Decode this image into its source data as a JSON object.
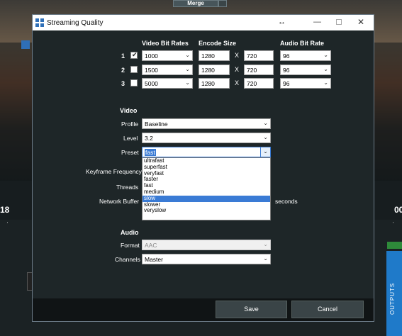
{
  "background": {
    "merge_label": "Merge",
    "left_number": "18",
    "right_number": "00",
    "outputs_label": "OUTPUTS"
  },
  "dialog": {
    "title": "Streaming Quality",
    "move_glyph": "↔",
    "minimize_glyph": "—",
    "close_glyph": "✕"
  },
  "table": {
    "headers": {
      "video_bit_rates": "Video Bit Rates",
      "encode_size": "Encode Size",
      "audio_bit_rate": "Audio Bit Rate"
    },
    "separator": "X",
    "rows": [
      {
        "num": "1",
        "checked": true,
        "bitrate": "1000",
        "width": "1280",
        "height": "720",
        "audio": "96"
      },
      {
        "num": "2",
        "checked": false,
        "bitrate": "1500",
        "width": "1280",
        "height": "720",
        "audio": "96"
      },
      {
        "num": "3",
        "checked": false,
        "bitrate": "5000",
        "width": "1280",
        "height": "720",
        "audio": "96"
      }
    ]
  },
  "video": {
    "section_label": "Video",
    "profile_label": "Profile",
    "profile_value": "Baseline",
    "level_label": "Level",
    "level_value": "3.2",
    "preset_label": "Preset",
    "preset_value": "fast",
    "keyframe_label": "Keyframe Frequency",
    "threads_label": "Threads",
    "network_buffer_label": "Network Buffer",
    "seconds_label": "seconds",
    "preset_options": [
      "ultrafast",
      "superfast",
      "veryfast",
      "faster",
      "fast",
      "medium",
      "slow",
      "slower",
      "veryslow"
    ],
    "highlighted_option": "slow"
  },
  "audio": {
    "section_label": "Audio",
    "format_label": "Format",
    "format_value": "AAC",
    "channels_label": "Channels",
    "channels_value": "Master"
  },
  "footer": {
    "save_label": "Save",
    "cancel_label": "Cancel"
  },
  "colors": {
    "dialog_bg": "#1e2628",
    "selection_blue": "#3a7bd5",
    "outputs_blue": "#1f7ac9"
  }
}
